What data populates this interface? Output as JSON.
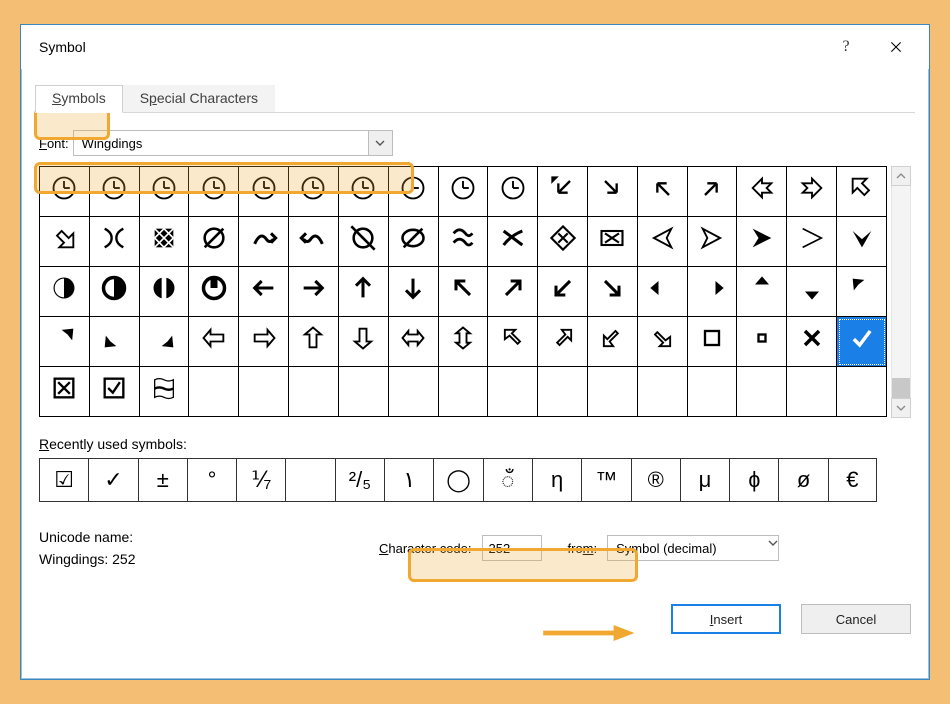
{
  "window": {
    "title": "Symbol"
  },
  "tabs": {
    "symbols": "Symbols",
    "special": "Special Characters",
    "active": "symbols"
  },
  "font": {
    "label": "Font:",
    "value": "Wingdings"
  },
  "recent": {
    "label": "Recently used symbols:",
    "items": [
      "☑",
      "✓",
      "±",
      "°",
      "⅟₇",
      "",
      "²/₅",
      "١",
      "◯",
      "ँ",
      "η",
      "™",
      "®",
      "μ",
      "ɸ",
      "ø",
      "€"
    ]
  },
  "unicode": {
    "name_lbl": "Unicode name:",
    "name_val": "Wingdings: 252"
  },
  "charcode": {
    "label": "Character code:",
    "value": "252"
  },
  "from": {
    "label": "from:",
    "value": "Symbol (decimal)"
  },
  "buttons": {
    "insert": "Insert",
    "cancel": "Cancel"
  },
  "grid": {
    "rows": [
      [
        "t-clock",
        "t-clock",
        "t-clock",
        "t-clock",
        "t-clock",
        "t-clock",
        "t-clock",
        "t-clock",
        "t-clock",
        "t-clock",
        "arr-dl",
        "arr-dr",
        "arr-ul",
        "arr-ur",
        "arr-fold-l",
        "arr-fold-r",
        "arr-fold-ul"
      ],
      [
        "arr-fold-dr",
        "petals",
        "weave",
        "slashO",
        "tildeR",
        "tildeL",
        "slashX",
        "slashOl",
        "tildeXR",
        "tildeXL",
        "dia-x",
        "box-x",
        "ang-l",
        "ang-r",
        "ang-solid",
        "ang-hollow",
        "caret-down"
      ],
      [
        "circ-l",
        "circ-r",
        "circ-u",
        "circ-d",
        "arr-l",
        "arr-r",
        "arr-u",
        "arr-d",
        "arr-ul2",
        "arr-ur2",
        "arr-dl2",
        "arr-dr2",
        "arr-bl",
        "arr-br",
        "arr-bu",
        "arr-bd",
        "arr-bul"
      ],
      [
        "arr-bur",
        "arr-bdl",
        "arr-bdr",
        "holl-l",
        "holl-r",
        "holl-u",
        "holl-d",
        "holl-lr",
        "holl-ud",
        "open-ul",
        "open-ur",
        "open-dl",
        "open-dr",
        "sq-big",
        "sq-small",
        "x-mark",
        "check"
      ],
      [
        "box-x2",
        "box-check",
        "win-flag",
        "",
        "",
        "",
        "",
        "",
        "",
        "",
        "",
        "",
        "",
        "",
        "",
        "",
        ""
      ]
    ],
    "selected": {
      "r": 3,
      "c": 16
    }
  },
  "icons": {
    "t-clock": "<circle cx='12' cy='12' r='9' fill='none' stroke='#000' stroke-width='1.6'/><line x1='12' y1='12' x2='12' y2='6' stroke='#000' stroke-width='1.6'/><line x1='12' y1='12' x2='17' y2='12' stroke='#000' stroke-width='1.6'/>",
    "arr-dl": "<path d='M18 6 L8 16 M8 16 L8 8 M8 16 L16 16 M3 6 L6 3 L3 3 Z' fill='none' stroke='#000' stroke-width='2'/>",
    "arr-dr": "<path d='M6 6 L16 16 M16 16 L16 8 M16 16 L8 16' fill='none' stroke='#000' stroke-width='2'/>",
    "arr-ul": "<path d='M18 18 L8 8 M8 8 L8 16 M8 8 L16 8' fill='none' stroke='#000' stroke-width='2'/>",
    "arr-ur": "<path d='M6 18 L16 8 M16 8 L8 8 M16 8 L16 16' fill='none' stroke='#000' stroke-width='2'/>",
    "arr-fold-l": "<path d='M4 12 L12 4 L12 8 L20 8 L16 12 L20 16 L12 16 L12 20 Z' fill='none' stroke='#000' stroke-width='1.6'/>",
    "arr-fold-r": "<path d='M20 12 L12 4 L12 8 L4 8 L8 12 L4 16 L12 16 L12 20 Z' fill='none' stroke='#000' stroke-width='1.6'/>",
    "arr-fold-ul": "<path d='M4 16 L4 4 L16 4 L12 8 L18 14 L14 18 L8 12 Z' fill='none' stroke='#000' stroke-width='1.6'/>",
    "arr-fold-dr": "<path d='M20 8 L20 20 L8 20 L12 16 L6 10 L10 6 L16 12 Z' fill='none' stroke='#000' stroke-width='1.6'/>",
    "petals": "<path d='M4 4 C12 8 12 16 4 20 M20 4 C12 8 12 16 20 20' fill='none' stroke='#000' stroke-width='2'/>",
    "weave": "<rect x='4' y='4' width='16' height='16' fill='#000'/><path d='M4 4 L20 20 M20 4 L4 20 M4 12 L12 4 M12 20 L20 12 M4 12 L12 20 M12 4 L20 12' stroke='#fff' stroke-width='1.4'/>",
    "slashO": "<circle cx='12' cy='12' r='8' fill='none' stroke='#000' stroke-width='2.2'/><line x1='4' y1='20' x2='20' y2='4' stroke='#000' stroke-width='2.2'/>",
    "tildeR": "<path d='M4 17 Q9 6 14 13 Q17 17 20 13 M18 8 L22 12 L18 16' fill='none' stroke='#000' stroke-width='2.6'/>",
    "tildeL": "<path d='M20 17 Q15 6 10 13 Q7 17 4 13 M6 8 L2 12 L6 16' fill='none' stroke='#000' stroke-width='2.6'/>",
    "slashX": "<circle cx='12' cy='12' r='8' fill='none' stroke='#000' stroke-width='2.2'/><line x1='2' y1='2' x2='22' y2='22' stroke='#000' stroke-width='2.2'/>",
    "slashOl": "<ellipse cx='12' cy='12' rx='9' ry='7' fill='none' stroke='#000' stroke-width='2.2'/><line x1='4' y1='20' x2='20' y2='4' stroke='#000' stroke-width='2.2'/>",
    "tildeXR": "<path d='M4 8 Q9 2 14 8 Q17 12 20 8 M4 16 Q9 10 14 16 Q17 20 20 16' fill='none' stroke='#000' stroke-width='2.4'/>",
    "tildeXL": "<path d='M4 6 L20 18 M4 18 Q10 10 20 6' fill='none' stroke='#000' stroke-width='2.6'/>",
    "dia-x": "<path d='M12 2 L22 12 L12 22 L2 12 Z' fill='none' stroke='#000' stroke-width='1.8'/><path d='M8 8 L16 16 M16 8 L8 16' stroke='#000' stroke-width='1.8'/>",
    "box-x": "<rect x='3' y='6' width='18' height='12' fill='none' stroke='#000' stroke-width='1.8'/><path d='M6 8 L18 16 M18 8 L6 16' stroke='#000' stroke-width='1.8'/>",
    "ang-l": "<path d='M20 4 L5 12 L20 20 L16 12 Z' fill='none' stroke='#000' stroke-width='1.6'/>",
    "ang-r": "<path d='M4 4 L19 12 L4 20 L8 12 Z' fill='none' stroke='#000' stroke-width='1.6'/>",
    "ang-solid": "<path d='M4 4 L20 12 L4 20 L9 12 Z' fill='#000'/>",
    "ang-hollow": "<path d='M4 4 L20 12 L4 20' fill='none' stroke='#000' stroke-width='1.4'/>",
    "caret-down": "<path d='M4 6 L12 20 L20 6 L12 13 Z' fill='#000'/>",
    "circ-l": "<circle cx='12' cy='12' r='9' fill='#000'/><path d='M12 4 A8 8 0 0 0 12 20 Z' fill='#fff'/>",
    "circ-r": "<circle cx='12' cy='12' r='9' fill='none' stroke='#000' stroke-width='3'/><path d='M12 4 A8 8 0 0 1 12 20' fill='#000'/>",
    "circ-u": "<circle cx='12' cy='12' r='9' fill='#000'/><rect x='10' y='3' width='4' height='18' fill='#fff'/>",
    "circ-d": "<circle cx='12' cy='12' r='9' fill='none' stroke='#000' stroke-width='3'/><rect x='9' y='3' width='6' height='9' fill='#000'/>",
    "arr-l": "<path d='M20 12 L6 12 M10 6 L4 12 L10 18' fill='none' stroke='#000' stroke-width='2.6'/>",
    "arr-r": "<path d='M4 12 L18 12 M14 6 L20 12 L14 18' fill='none' stroke='#000' stroke-width='2.6'/>",
    "arr-u": "<path d='M12 20 L12 6 M6 10 L12 4 L18 10' fill='none' stroke='#000' stroke-width='2.6'/>",
    "arr-d": "<path d='M12 4 L12 18 M6 14 L12 20 L18 14' fill='none' stroke='#000' stroke-width='2.6'/>",
    "arr-ul2": "<path d='M18 18 L7 7 M6 14 L6 6 L14 6' fill='none' stroke='#000' stroke-width='2.6'/>",
    "arr-ur2": "<path d='M6 18 L17 7 M10 6 L18 6 L18 14' fill='none' stroke='#000' stroke-width='2.6'/>",
    "arr-dl2": "<path d='M18 6 L7 17 M6 10 L6 18 L14 18' fill='none' stroke='#000' stroke-width='2.6'/>",
    "arr-dr2": "<path d='M6 6 L17 17 M18 10 L18 18 L10 18' fill='none' stroke='#000' stroke-width='2.6'/>",
    "arr-bl": "<path d='M22 12 L9 12 L9 6 L2 12 L9 18 L9 12' fill='#000'/>",
    "arr-br": "<path d='M2 12 L15 12 L15 6 L22 12 L15 18 L15 12' fill='#000'/>",
    "arr-bu": "<path d='M12 22 L12 9 L6 9 L12 2 L18 9 L12 9' fill='#000'/>",
    "arr-bd": "<path d='M12 2 L12 15 L6 15 L12 22 L18 15 L12 15' fill='#000'/>",
    "arr-bul": "<path d='M20 20 L9 9 L14 5 L4 4 L5 14 L9 9' fill='#000'/>",
    "arr-bur": "<path d='M4 20 L15 9 L10 5 L20 4 L19 14 L15 9' fill='#000'/>",
    "arr-bdl": "<path d='M20 4 L9 15 L14 19 L4 20 L5 10 L9 15' fill='#000'/>",
    "arr-bdr": "<path d='M4 4 L15 15 L10 19 L20 20 L19 10 L15 15' fill='#000'/>",
    "holl-l": "<path d='M20 9 L9 9 L9 5 L3 12 L9 19 L9 15 L20 15 Z' fill='none' stroke='#000' stroke-width='1.6'/>",
    "holl-r": "<path d='M4 9 L15 9 L15 5 L21 12 L15 19 L15 15 L4 15 Z' fill='none' stroke='#000' stroke-width='1.6'/>",
    "holl-u": "<path d='M9 20 L9 9 L5 9 L12 3 L19 9 L15 9 L15 20 Z' fill='none' stroke='#000' stroke-width='1.6'/>",
    "holl-d": "<path d='M9 4 L9 15 L5 15 L12 21 L19 15 L15 15 L15 4 Z' fill='none' stroke='#000' stroke-width='1.6'/>",
    "holl-lr": "<path d='M3 12 L8 6 L8 9 L16 9 L16 6 L21 12 L16 18 L16 15 L8 15 L8 18 Z' fill='none' stroke='#000' stroke-width='1.6'/>",
    "holl-ud": "<path d='M12 3 L6 8 L9 8 L9 16 L6 16 L12 21 L18 16 L15 16 L15 8 L18 8 Z' fill='none' stroke='#000' stroke-width='1.6'/>",
    "open-ul": "<path d='M5 5 L5 13 L9 10 L16 17 L18 15 L11 8 L14 5 Z' fill='none' stroke='#000' stroke-width='1.6'/>",
    "open-ur": "<path d='M19 5 L11 5 L14 9 L7 16 L9 18 L16 11 L19 14 Z' fill='none' stroke='#000' stroke-width='1.6'/>",
    "open-dl": "<path d='M5 19 L13 19 L10 15 L17 8 L15 6 L8 13 L5 10 Z' fill='none' stroke='#000' stroke-width='1.6'/>",
    "open-dr": "<path d='M19 19 L19 11 L15 14 L8 7 L6 9 L13 16 L10 19 Z' fill='none' stroke='#000' stroke-width='1.6'/>",
    "sq-big": "<rect x='6' y='6' width='12' height='12' fill='none' stroke='#000' stroke-width='2'/>",
    "sq-small": "<rect x='9' y='9' width='6' height='6' fill='none' stroke='#000' stroke-width='2'/>",
    "x-mark": "<path d='M6 6 L18 18 M18 6 L6 18' stroke='#000' stroke-width='3'/>",
    "check": "<path d='M5 13 L10 18 L19 6' fill='none' stroke='currentColor' stroke-width='3'/>",
    "box-x2": "<rect x='4' y='4' width='16' height='16' fill='none' stroke='#000' stroke-width='2'/><path d='M7 7 L17 17 M17 7 L7 17' stroke='#000' stroke-width='2'/>",
    "box-check": "<rect x='4' y='4' width='16' height='16' fill='none' stroke='#000' stroke-width='2'/><path d='M7 12 L11 16 L17 7' fill='none' stroke='#000' stroke-width='2'/>",
    "win-flag": "<path d='M4 5 Q8 3 12 5 Q16 7 20 5 L20 12 Q16 14 12 12 Q8 10 4 12 Z M4 13 Q8 11 12 13 Q16 15 20 13 L20 20 Q16 22 12 20 Q8 18 4 20 Z' fill='none' stroke='#000' stroke-width='1.1'/>"
  }
}
